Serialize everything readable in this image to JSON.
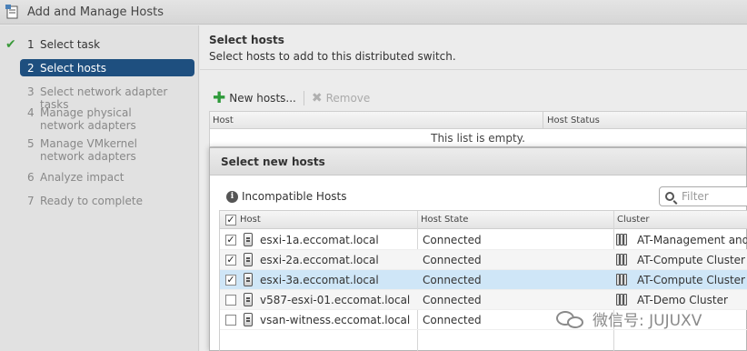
{
  "window": {
    "title": "Add and Manage Hosts"
  },
  "steps": [
    {
      "num": "1",
      "label": "Select task",
      "state": "done"
    },
    {
      "num": "2",
      "label": "Select hosts",
      "state": "active"
    },
    {
      "num": "3",
      "label": "Select network adapter tasks",
      "state": "pending"
    },
    {
      "num": "4",
      "label": "Manage physical network adapters",
      "state": "pending"
    },
    {
      "num": "5",
      "label": "Manage VMkernel network adapters",
      "state": "pending"
    },
    {
      "num": "6",
      "label": "Analyze impact",
      "state": "pending"
    },
    {
      "num": "7",
      "label": "Ready to complete",
      "state": "pending"
    }
  ],
  "main": {
    "title": "Select hosts",
    "subtitle": "Select hosts to add to this distributed switch.",
    "toolbar": {
      "new_hosts": "New hosts...",
      "remove": "Remove"
    },
    "grid": {
      "col_host": "Host",
      "col_status": "Host Status",
      "empty": "This list is empty."
    }
  },
  "dialog": {
    "title": "Select new hosts",
    "incompatible": "Incompatible Hosts",
    "filter_placeholder": "Filter",
    "columns": {
      "host": "Host",
      "state": "Host State",
      "cluster": "Cluster"
    },
    "rows": [
      {
        "host": "esxi-1a.eccomat.local",
        "state": "Connected",
        "cluster": "AT-Management and E",
        "checked": true,
        "selected": false
      },
      {
        "host": "esxi-2a.eccomat.local",
        "state": "Connected",
        "cluster": "AT-Compute Cluster",
        "checked": true,
        "selected": false
      },
      {
        "host": "esxi-3a.eccomat.local",
        "state": "Connected",
        "cluster": "AT-Compute Cluster",
        "checked": true,
        "selected": true
      },
      {
        "host": "v587-esxi-01.eccomat.local",
        "state": "Connected",
        "cluster": "AT-Demo Cluster",
        "checked": false,
        "selected": false
      },
      {
        "host": "vsan-witness.eccomat.local",
        "state": "Connected",
        "cluster": "",
        "checked": false,
        "selected": false
      }
    ]
  },
  "watermark": {
    "text": "微信号: JUJUXV"
  }
}
